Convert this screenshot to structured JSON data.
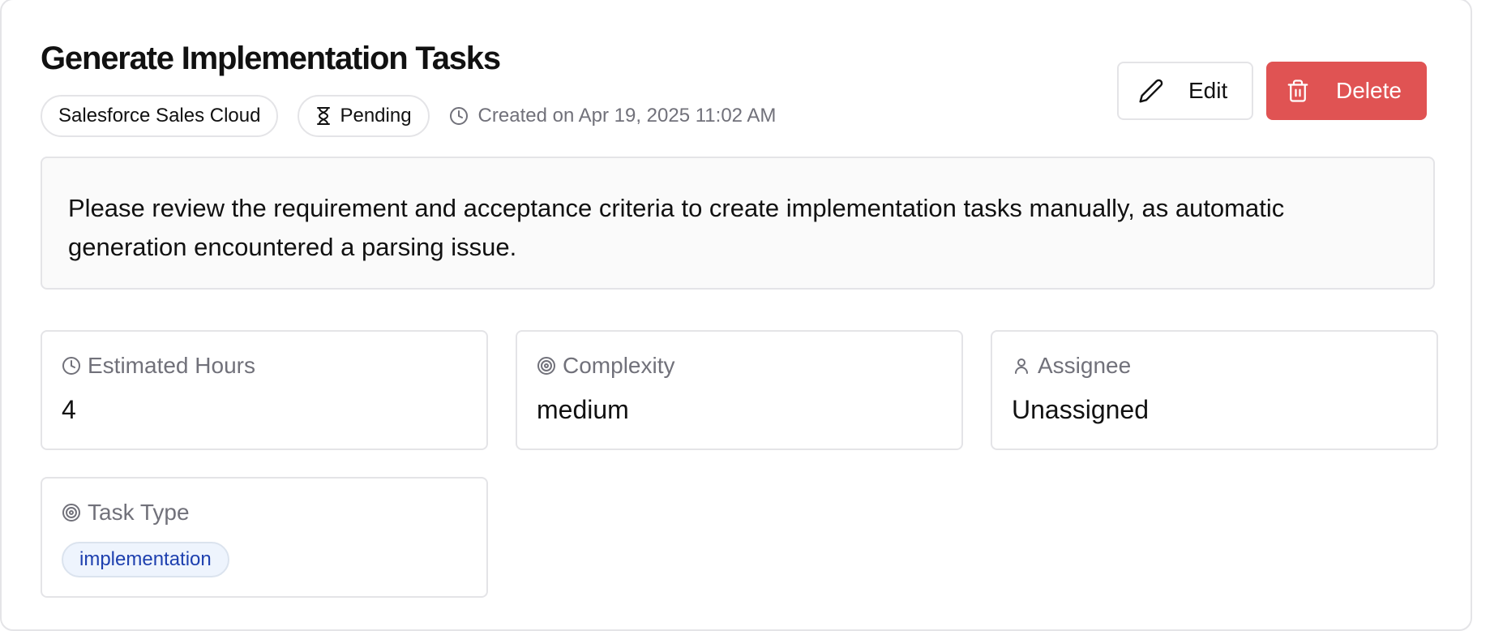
{
  "task": {
    "title": "Generate Implementation Tasks",
    "project": "Salesforce Sales Cloud",
    "status": "Pending",
    "created": "Created on Apr 19, 2025 11:02 AM",
    "description": "Please review the requirement and acceptance criteria to create implementation tasks manually, as automatic generation encountered a parsing issue."
  },
  "actions": {
    "edit_label": "Edit",
    "delete_label": "Delete"
  },
  "fields": {
    "estimated_hours": {
      "label": "Estimated Hours",
      "value": "4",
      "icon": "clock-icon"
    },
    "complexity": {
      "label": "Complexity",
      "value": "medium",
      "icon": "target-icon"
    },
    "assignee": {
      "label": "Assignee",
      "value": "Unassigned",
      "icon": "user-icon"
    },
    "task_type": {
      "label": "Task Type",
      "value": "implementation",
      "icon": "target-icon"
    }
  },
  "colors": {
    "delete": "#e05353",
    "border": "#e4e4e7",
    "muted_text": "#71717a",
    "tag_bg": "#eef4fd",
    "tag_text": "#1e40af"
  }
}
